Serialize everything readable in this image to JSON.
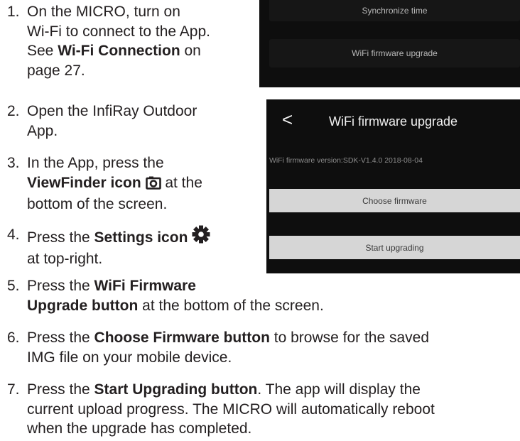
{
  "steps": [
    {
      "num": "1.",
      "parts": [
        "On the MICRO, turn on",
        "Wi-Fi to connect to the App.",
        "See ",
        "Wi-Fi Connection",
        " on",
        "page 27."
      ]
    },
    {
      "num": "2.",
      "line1": "Open the InfiRay Outdoor",
      "line2": "App."
    },
    {
      "num": "3.",
      "p1": "In the App, press the",
      "bold": "ViewFinder icon",
      "p2": " at the",
      "p3": "bottom of the screen."
    },
    {
      "num": "4.",
      "p1": "Press the ",
      "bold": "Settings icon",
      "p2": "at top-right."
    },
    {
      "num": "5.",
      "p1": "Press the ",
      "bold1": "WiFi Firmware",
      "bold2": "Upgrade button",
      "p2": " at the bottom of the screen."
    },
    {
      "num": "6.",
      "p1": "Press the ",
      "bold": "Choose Firmware button",
      "p2": " to browse for the saved",
      "p3": "IMG file on your mobile device."
    },
    {
      "num": "7.",
      "p1": "Press the ",
      "bold": "Start Upgrading button",
      "p2": ". The app will display the",
      "p3": "current upload progress. The MICRO will automatically reboot",
      "p4": "when the upgrade has completed."
    }
  ],
  "screen1": {
    "sync_label": "Synchronize time",
    "wifi_upgrade_label": "WiFi firmware upgrade"
  },
  "screen2": {
    "title": "WiFi firmware upgrade",
    "back_glyph": "<",
    "version_text": "WiFi firmware version:SDK-V1.4.0 2018-08-04",
    "choose_label": "Choose firmware",
    "start_label": "Start upgrading"
  },
  "icons": [
    "viewfinder-icon",
    "settings-icon"
  ]
}
